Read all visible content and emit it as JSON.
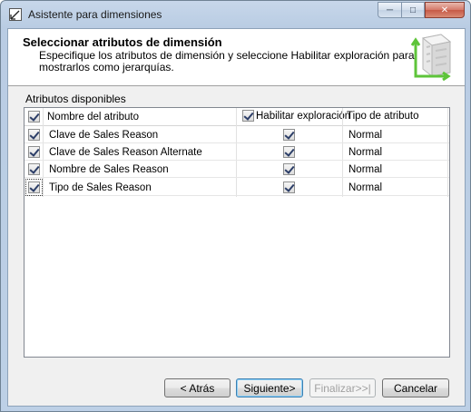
{
  "window": {
    "title": "Asistente para dimensiones",
    "minimize_label": "─",
    "maximize_label": "□",
    "close_label": "✕"
  },
  "header": {
    "title": "Seleccionar atributos de dimensión",
    "description": "Especifique los atributos de dimensión y seleccione Habilitar exploración para mostrarlos como jerarquías."
  },
  "attributes": {
    "section_label": "Atributos disponibles",
    "columns": {
      "name": "Nombre del atributo",
      "browse": "Habilitar exploración",
      "type": "Tipo de atributo"
    },
    "select_all_checked": true,
    "browse_all_checked": true,
    "rows": [
      {
        "checked": true,
        "name": "Clave de Sales Reason",
        "browse": true,
        "type": "Normal"
      },
      {
        "checked": true,
        "name": "Clave de Sales Reason Alternate",
        "browse": true,
        "type": "Normal"
      },
      {
        "checked": true,
        "name": "Nombre de Sales Reason",
        "browse": true,
        "type": "Normal"
      },
      {
        "checked": true,
        "name": "Tipo de Sales Reason",
        "browse": true,
        "type": "Normal"
      }
    ]
  },
  "buttons": {
    "back": "< Atrás",
    "next": "Siguiente>",
    "finish": "Finalizar>>|",
    "cancel": "Cancelar"
  }
}
